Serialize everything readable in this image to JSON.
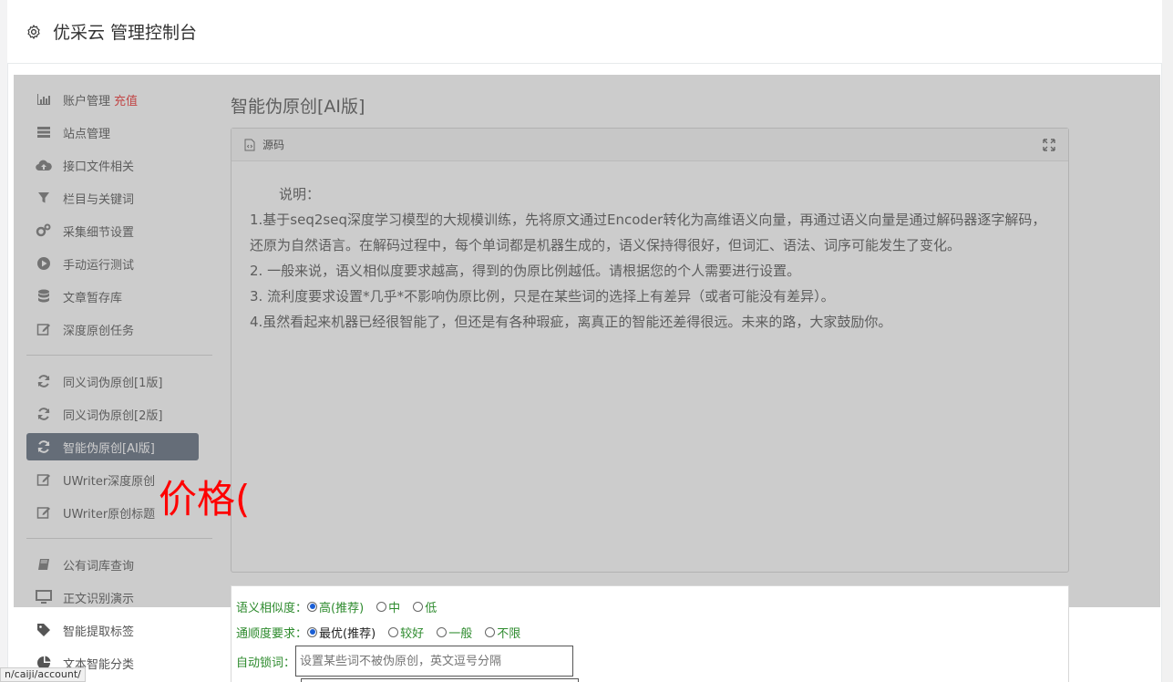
{
  "header": {
    "title": "优采云 管理控制台"
  },
  "sidebar": {
    "items": [
      {
        "label": "账户管理",
        "badge": "充值",
        "icon": "bar-chart-icon"
      },
      {
        "label": "站点管理",
        "icon": "server-icon"
      },
      {
        "label": "接口文件相关",
        "icon": "cloud-upload-icon"
      },
      {
        "label": "栏目与关键词",
        "icon": "filter-icon"
      },
      {
        "label": "采集细节设置",
        "icon": "cogs-icon"
      },
      {
        "label": "手动运行测试",
        "icon": "play-circle-icon"
      },
      {
        "label": "文章暂存库",
        "icon": "database-icon"
      },
      {
        "label": "深度原创任务",
        "icon": "edit-icon"
      },
      {
        "label": "同义词伪原创[1版]",
        "icon": "refresh-icon"
      },
      {
        "label": "同义词伪原创[2版]",
        "icon": "refresh-icon"
      },
      {
        "label": "智能伪原创[AI版]",
        "icon": "refresh-icon",
        "active": true
      },
      {
        "label": "UWriter深度原创",
        "icon": "edit-icon"
      },
      {
        "label": "UWriter原创标题",
        "icon": "edit-icon"
      },
      {
        "label": "公有词库查询",
        "icon": "book-icon"
      },
      {
        "label": "正文识别演示",
        "icon": "monitor-icon"
      },
      {
        "label": "智能提取标签",
        "icon": "tag-icon"
      },
      {
        "label": "文本智能分类",
        "icon": "pie-chart-icon"
      }
    ]
  },
  "main": {
    "title": "智能伪原创[AI版]",
    "panel": {
      "heading": "源码",
      "intro": "说明：",
      "paragraphs": [
        "1.基于seq2seq深度学习模型的大规模训练，先将原文通过Encoder转化为高维语义向量，再通过语义向量是通过解码器逐字解码，还原为自然语言。在解码过程中，每个单词都是机器生成的，语义保持得很好，但词汇、语法、词序可能发生了变化。",
        "2. 一般来说，语义相似度要求越高，得到的伪原比例越低。请根据您的个人需要进行设置。",
        "3. 流利度要求设置*几乎*不影响伪原比例，只是在某些词的选择上有差异（或者可能没有差异）。",
        "4.虽然看起来机器已经很智能了，但还是有各种瑕疵，离真正的智能还差得很远。未来的路，大家鼓励你。"
      ]
    },
    "form": {
      "similarity_label": "语义相似度：",
      "similarity_options": [
        "高(推荐)",
        "中",
        "低"
      ],
      "fluency_label": "通顺度要求：",
      "fluency_options": [
        "最优(推荐)",
        "较好",
        "一般",
        "不限"
      ],
      "lock_label": "自动锁词：",
      "lock_placeholder": "设置某些词不被伪原创，英文逗号分隔"
    }
  },
  "overlay_text": "价格(",
  "status_bar": {
    "url": "n/caiji/account/"
  }
}
